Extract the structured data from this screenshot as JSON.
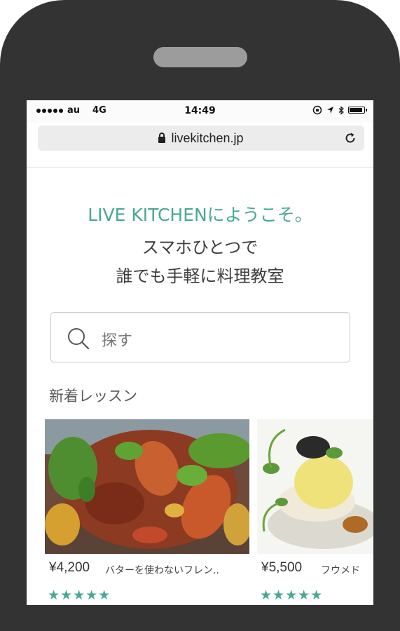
{
  "status_bar": {
    "carrier": "au",
    "network": "4G",
    "time": "14:49"
  },
  "browser": {
    "url": "livekitchen.jp"
  },
  "hero": {
    "title": "LIVE KITCHENにようこそ。",
    "line1": "スマホひとつで",
    "line2": "誰でも手軽に料理教室"
  },
  "search": {
    "placeholder": "探す"
  },
  "section": {
    "title": "新着レッスン"
  },
  "lessons": [
    {
      "price": "¥4,200",
      "name": "バターを使わないフレン..",
      "rating": 5
    },
    {
      "price": "¥5,500",
      "name": "フウメド",
      "rating": 5
    }
  ],
  "colors": {
    "accent": "#48a895",
    "phone_body": "#333333"
  }
}
